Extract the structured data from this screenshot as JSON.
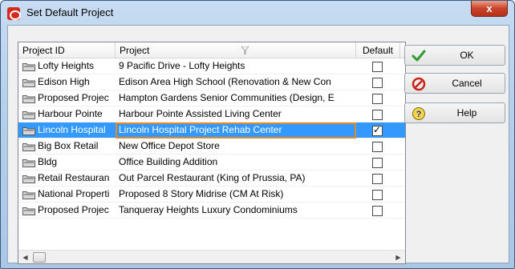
{
  "window": {
    "title": "Set Default Project",
    "close_label": "x"
  },
  "grid": {
    "columns": {
      "id": "Project ID",
      "name": "Project",
      "default": "Default"
    },
    "rows": [
      {
        "id": "Lofty Heights",
        "name": "9 Pacific Drive - Lofty Heights",
        "default": false
      },
      {
        "id": "Edison High",
        "name": "Edison Area High School (Renovation & New Con",
        "default": false
      },
      {
        "id": "Proposed Projec",
        "name": "Hampton Gardens Senior Communities (Design, E",
        "default": false
      },
      {
        "id": "Harbour Pointe",
        "name": "Harbour Pointe Assisted Living Center",
        "default": false
      },
      {
        "id": "Lincoln Hospital",
        "name": "Lincoln Hospital Project Rehab Center",
        "default": true
      },
      {
        "id": "Big Box Retail",
        "name": "New Office Depot Store",
        "default": false
      },
      {
        "id": "Bldg",
        "name": "Office Building Addition",
        "default": false
      },
      {
        "id": "Retail Restauran",
        "name": "Out Parcel Restaurant (King of Prussia, PA)",
        "default": false
      },
      {
        "id": "National Properti",
        "name": "Proposed 8 Story Midrise (CM At Risk)",
        "default": false
      },
      {
        "id": "Proposed Projec",
        "name": "Tanqueray Heights Luxury Condominiums",
        "default": false
      }
    ],
    "selected_row": 4
  },
  "buttons": {
    "ok": "OK",
    "cancel": "Cancel",
    "help": "Help"
  },
  "colors": {
    "selection": "#3399ff",
    "selection_outline": "#e08a2c"
  }
}
